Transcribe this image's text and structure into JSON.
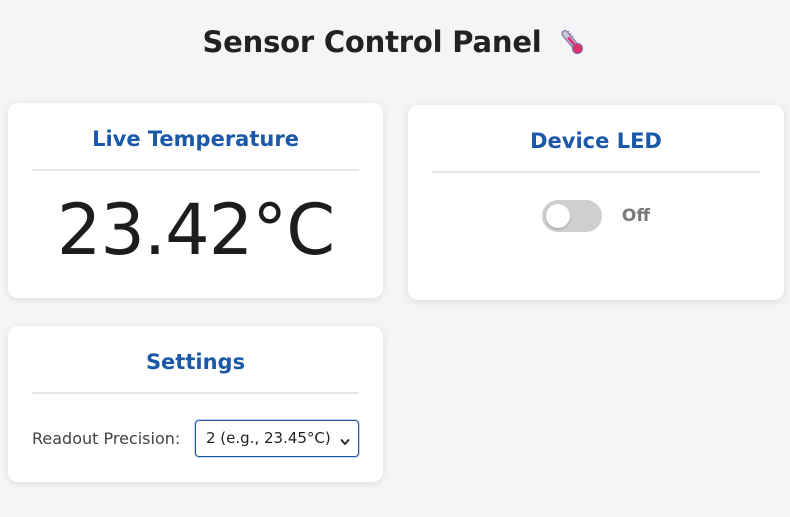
{
  "page": {
    "title": "Sensor Control Panel",
    "title_icon": "thermometer-icon"
  },
  "temperature_card": {
    "title": "Live Temperature",
    "reading": "23.42°C"
  },
  "led_card": {
    "title": "Device LED",
    "toggle_on": false,
    "state_label": "Off"
  },
  "settings_card": {
    "title": "Settings",
    "precision_label": "Readout Precision:",
    "precision_selected": "2 (e.g., 23.45°C)"
  },
  "colors": {
    "accent": "#1b59a8",
    "background": "#f4f5f7",
    "toggle_off": "#cfcfcf"
  }
}
